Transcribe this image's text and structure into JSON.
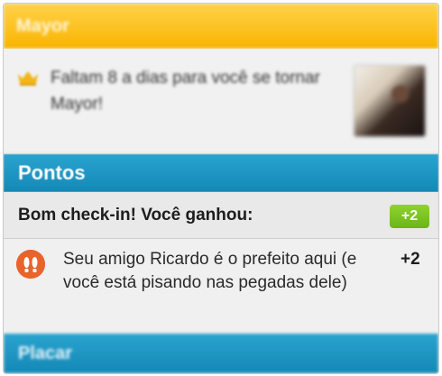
{
  "mayor": {
    "header": "Mayor",
    "message": "Faltam 8 a dias para você se tornar Mayor!"
  },
  "pontos": {
    "header": "Pontos",
    "checkin_label": "Bom check-in! Você ganhou:",
    "checkin_points": "+2",
    "friend_message": "Seu amigo Ricardo é o prefeito aqui (e você está pisando nas pegadas dele)",
    "friend_points": "+2"
  },
  "placar": {
    "header": "Placar"
  },
  "icons": {
    "mayor": "crown-icon",
    "friend": "footprints-icon"
  },
  "colors": {
    "mayor_bar": "#f9b400",
    "section_bar": "#1488b6",
    "badge": "#6ab51a",
    "friend_icon": "#e8642c"
  }
}
